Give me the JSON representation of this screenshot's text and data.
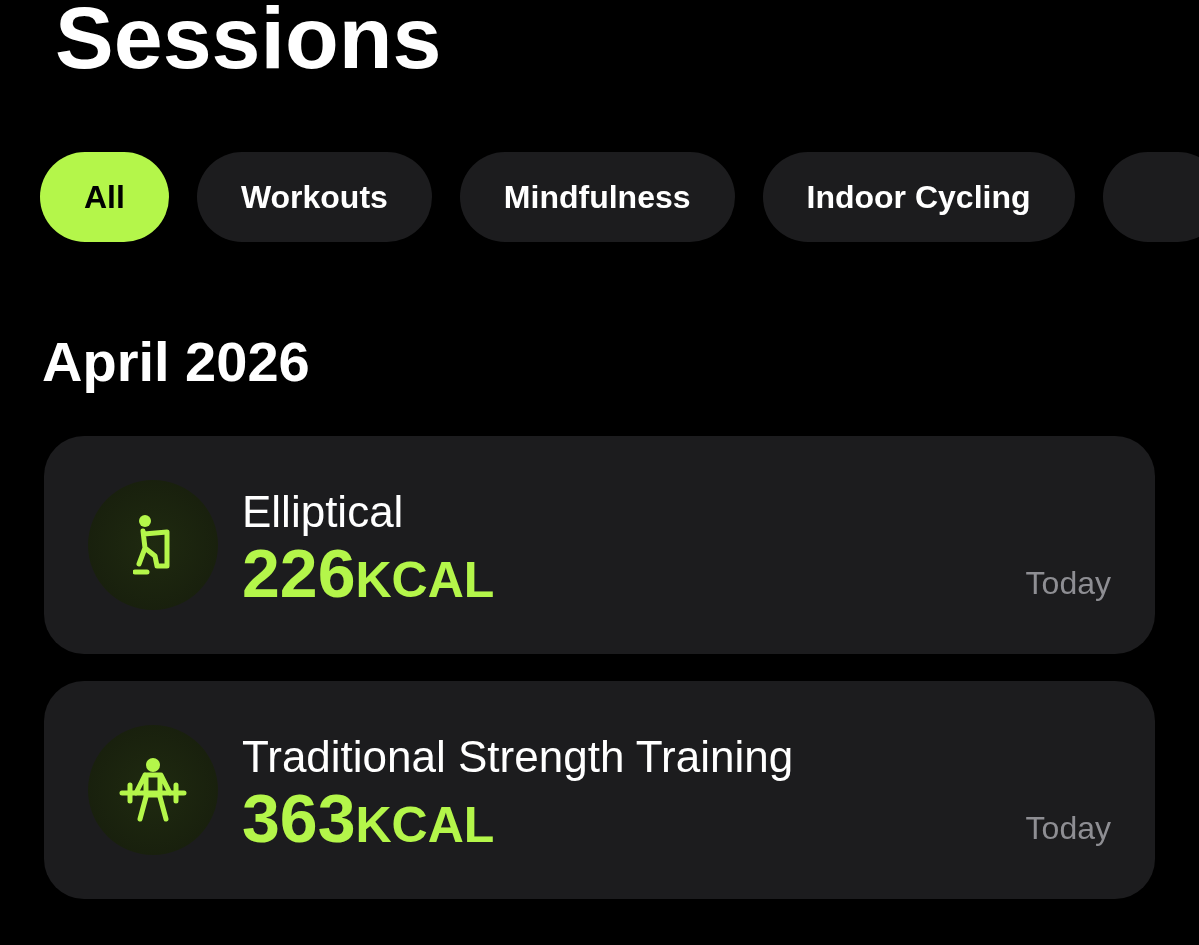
{
  "title": "Sessions",
  "filters": [
    {
      "label": "All",
      "selected": true
    },
    {
      "label": "Workouts",
      "selected": false
    },
    {
      "label": "Mindfulness",
      "selected": false
    },
    {
      "label": "Indoor Cycling",
      "selected": false
    }
  ],
  "section": "April 2026",
  "sessions": [
    {
      "kind": "elliptical",
      "name": "Elliptical",
      "value": "226",
      "unit": "KCAL",
      "date": "Today"
    },
    {
      "kind": "strength",
      "name": "Traditional Strength Training",
      "value": "363",
      "unit": "KCAL",
      "date": "Today"
    }
  ]
}
